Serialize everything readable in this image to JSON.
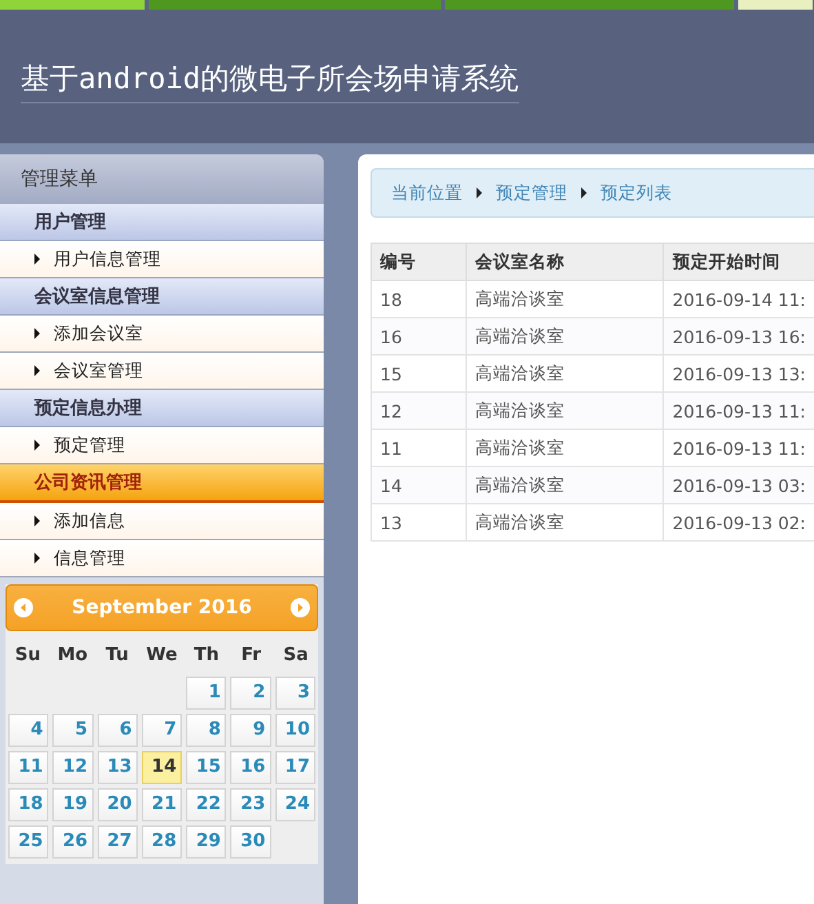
{
  "header": {
    "title": "基于android的微电子所会场申请系统"
  },
  "sidebar": {
    "title": "管理菜单",
    "groups": [
      {
        "label": "用户管理",
        "selected": false,
        "items": [
          {
            "label": "用户信息管理"
          }
        ]
      },
      {
        "label": "会议室信息管理",
        "selected": false,
        "items": [
          {
            "label": "添加会议室"
          },
          {
            "label": "会议室管理"
          }
        ]
      },
      {
        "label": "预定信息办理",
        "selected": false,
        "items": [
          {
            "label": "预定管理"
          }
        ]
      },
      {
        "label": "公司资讯管理",
        "selected": true,
        "items": [
          {
            "label": "添加信息"
          },
          {
            "label": "信息管理"
          }
        ]
      }
    ]
  },
  "calendar": {
    "title": "September 2016",
    "weekdays": [
      "Su",
      "Mo",
      "Tu",
      "We",
      "Th",
      "Fr",
      "Sa"
    ],
    "weeks": [
      [
        {
          "day": "1",
          "selected": false
        },
        {
          "day": "2",
          "selected": false
        },
        {
          "day": "3",
          "selected": false
        }
      ],
      [
        {
          "day": "4",
          "selected": false
        },
        {
          "day": "5",
          "selected": false
        },
        {
          "day": "6",
          "selected": false
        },
        {
          "day": "7",
          "selected": false
        },
        {
          "day": "8",
          "selected": false
        },
        {
          "day": "9",
          "selected": false
        },
        {
          "day": "10",
          "selected": false
        }
      ],
      [
        {
          "day": "11",
          "selected": false
        },
        {
          "day": "12",
          "selected": false
        },
        {
          "day": "13",
          "selected": false
        },
        {
          "day": "14",
          "selected": true
        },
        {
          "day": "15",
          "selected": false
        },
        {
          "day": "16",
          "selected": false
        },
        {
          "day": "17",
          "selected": false
        }
      ],
      [
        {
          "day": "18",
          "selected": false
        },
        {
          "day": "19",
          "selected": false
        },
        {
          "day": "20",
          "selected": false
        },
        {
          "day": "21",
          "selected": false
        },
        {
          "day": "22",
          "selected": false
        },
        {
          "day": "23",
          "selected": false
        },
        {
          "day": "24",
          "selected": false
        }
      ],
      [
        {
          "day": "25",
          "selected": false
        },
        {
          "day": "26",
          "selected": false
        },
        {
          "day": "27",
          "selected": false
        },
        {
          "day": "28",
          "selected": false
        },
        {
          "day": "29",
          "selected": false
        },
        {
          "day": "30",
          "selected": false
        }
      ]
    ]
  },
  "breadcrumb": [
    "当前位置",
    "预定管理",
    "预定列表"
  ],
  "table": {
    "columns": [
      "编号",
      "会议室名称",
      "预定开始时间"
    ],
    "rows": [
      [
        "18",
        "高端洽谈室",
        "2016-09-14 11:"
      ],
      [
        "16",
        "高端洽谈室",
        "2016-09-13 16:"
      ],
      [
        "15",
        "高端洽谈室",
        "2016-09-13 13:"
      ],
      [
        "12",
        "高端洽谈室",
        "2016-09-13 11:"
      ],
      [
        "11",
        "高端洽谈室",
        "2016-09-13 11:"
      ],
      [
        "14",
        "高端洽谈室",
        "2016-09-13 03:"
      ],
      [
        "13",
        "高端洽谈室",
        "2016-09-13 02:"
      ]
    ]
  }
}
